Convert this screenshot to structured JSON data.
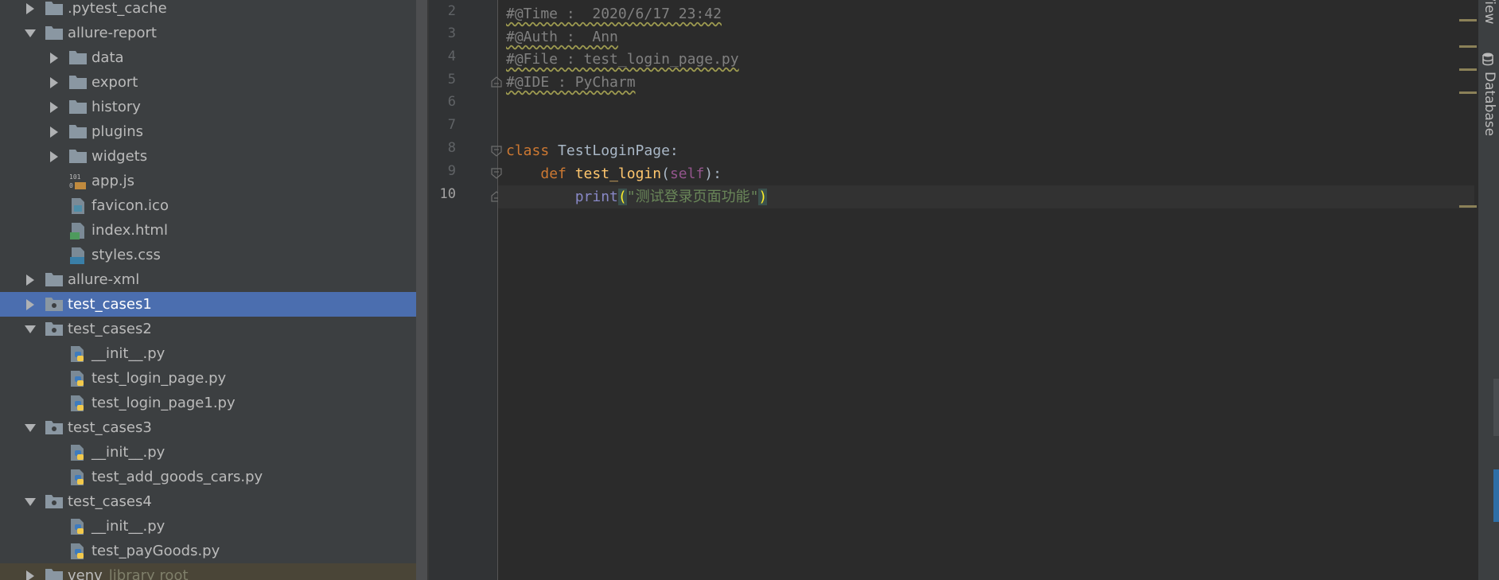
{
  "project_tree": {
    "items": [
      {
        "label": ".pytest_cache",
        "indent": 0,
        "arrow": "right",
        "icon": "folder"
      },
      {
        "label": "allure-report",
        "indent": 0,
        "arrow": "down",
        "icon": "folder"
      },
      {
        "label": "data",
        "indent": 1,
        "arrow": "right",
        "icon": "folder"
      },
      {
        "label": "export",
        "indent": 1,
        "arrow": "right",
        "icon": "folder"
      },
      {
        "label": "history",
        "indent": 1,
        "arrow": "right",
        "icon": "folder"
      },
      {
        "label": "plugins",
        "indent": 1,
        "arrow": "right",
        "icon": "folder"
      },
      {
        "label": "widgets",
        "indent": 1,
        "arrow": "right",
        "icon": "folder"
      },
      {
        "label": "app.js",
        "indent": 1,
        "arrow": "none",
        "icon": "js-file"
      },
      {
        "label": "favicon.ico",
        "indent": 1,
        "arrow": "none",
        "icon": "image-file"
      },
      {
        "label": "index.html",
        "indent": 1,
        "arrow": "none",
        "icon": "html-file"
      },
      {
        "label": "styles.css",
        "indent": 1,
        "arrow": "none",
        "icon": "css-file"
      },
      {
        "label": "allure-xml",
        "indent": 0,
        "arrow": "right",
        "icon": "folder"
      },
      {
        "label": "test_cases1",
        "indent": 0,
        "arrow": "right",
        "icon": "package",
        "selected": true
      },
      {
        "label": "test_cases2",
        "indent": 0,
        "arrow": "down",
        "icon": "package"
      },
      {
        "label": "__init__.py",
        "indent": 1,
        "arrow": "none",
        "icon": "python-file"
      },
      {
        "label": "test_login_page.py",
        "indent": 1,
        "arrow": "none",
        "icon": "python-file"
      },
      {
        "label": "test_login_page1.py",
        "indent": 1,
        "arrow": "none",
        "icon": "python-file"
      },
      {
        "label": "test_cases3",
        "indent": 0,
        "arrow": "down",
        "icon": "package"
      },
      {
        "label": "__init__.py",
        "indent": 1,
        "arrow": "none",
        "icon": "python-file"
      },
      {
        "label": "test_add_goods_cars.py",
        "indent": 1,
        "arrow": "none",
        "icon": "python-file"
      },
      {
        "label": "test_cases4",
        "indent": 0,
        "arrow": "down",
        "icon": "package"
      },
      {
        "label": "__init__.py",
        "indent": 1,
        "arrow": "none",
        "icon": "python-file"
      },
      {
        "label": "test_payGoods.py",
        "indent": 1,
        "arrow": "none",
        "icon": "python-file"
      },
      {
        "label": "venv",
        "indent": 0,
        "arrow": "right",
        "icon": "folder",
        "suffix": "library root",
        "dim": true
      }
    ]
  },
  "editor": {
    "line_numbers": [
      "2",
      "3",
      "4",
      "5",
      "6",
      "7",
      "8",
      "9",
      "10"
    ],
    "current_line": "10",
    "code": {
      "l2": "#@Time :  2020/6/17 23:42",
      "l3": "#@Auth :  Ann",
      "l4": "#@File : test_login_page.py",
      "l5": "#@IDE : PyCharm",
      "l8_kw": "class",
      "l8_name": " TestLoginPage:",
      "l9_indent": "    ",
      "l9_kw": "def",
      "l9_fn": "test_login",
      "l9_open": "(",
      "l9_self": "self",
      "l9_close": "):",
      "l10_indent": "        ",
      "l10_builtin": "print",
      "l10_open": "(",
      "l10_string": "\"测试登录页面功能\"",
      "l10_close": ")"
    }
  },
  "right_toolbar": {
    "top_label": "View",
    "database_label": "Database"
  },
  "colors": {
    "tree_bg": "#3c3f41",
    "selection": "#4b6eaf",
    "editor_bg": "#2b2b2b",
    "keyword": "#cc7832",
    "function": "#ffc66d",
    "comment": "#808080",
    "string": "#6a8759"
  }
}
